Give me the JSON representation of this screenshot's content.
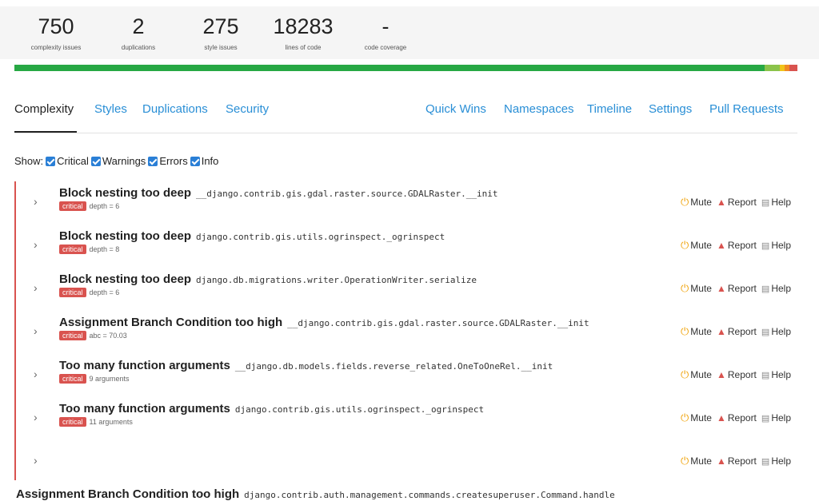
{
  "stats": [
    {
      "value": "750",
      "label": "complexity issues"
    },
    {
      "value": "2",
      "label": "duplications"
    },
    {
      "value": "275",
      "label": "style issues"
    },
    {
      "value": "18283",
      "label": "lines of code"
    },
    {
      "value": "-",
      "label": "code coverage"
    }
  ],
  "health_bar": {
    "segments": [
      {
        "fraction": 0.958,
        "color": "#27a844"
      },
      {
        "fraction": 0.02,
        "color": "#8bc34a"
      },
      {
        "fraction": 0.006,
        "color": "#f0c419"
      },
      {
        "fraction": 0.006,
        "color": "#f08a24"
      },
      {
        "fraction": 0.01,
        "color": "#d9534f"
      }
    ]
  },
  "tabs": {
    "left": [
      "Complexity",
      "Styles",
      "Duplications",
      "Security"
    ],
    "right": [
      "Quick Wins",
      "Namespaces",
      "Timeline",
      "Settings",
      "Pull Requests"
    ]
  },
  "filter": {
    "label": "Show:",
    "options": [
      "Critical",
      "Warnings",
      "Errors",
      "Info"
    ]
  },
  "issues": [
    {
      "title": "Block nesting too deep",
      "location": "__django.contrib.gis.gdal.raster.source.GDALRaster.__init",
      "severity": "critical",
      "detail": "depth = 6"
    },
    {
      "title": "Block nesting too deep",
      "location": "django.contrib.gis.utils.ogrinspect._ogrinspect",
      "severity": "critical",
      "detail": "depth = 8"
    },
    {
      "title": "Block nesting too deep",
      "location": "django.db.migrations.writer.OperationWriter.serialize",
      "severity": "critical",
      "detail": "depth = 6"
    },
    {
      "title": "Assignment Branch Condition too high",
      "location": "__django.contrib.gis.gdal.raster.source.GDALRaster.__init",
      "severity": "critical",
      "detail": "abc = 70.03"
    },
    {
      "title": "Too many function arguments",
      "location": "__django.db.models.fields.reverse_related.OneToOneRel.__init",
      "severity": "critical",
      "detail": "9 arguments"
    },
    {
      "title": "Too many function arguments",
      "location": "django.contrib.gis.utils.ogrinspect._ogrinspect",
      "severity": "critical",
      "detail": "11 arguments"
    },
    {
      "title": "",
      "location": "",
      "severity": "",
      "detail": ""
    }
  ],
  "actions": {
    "mute": "Mute",
    "report": "Report",
    "help": "Help"
  },
  "partial_issue": {
    "title": "Assignment Branch Condition too high",
    "location": "django.contrib.auth.management.commands.createsuperuser.Command.handle"
  }
}
